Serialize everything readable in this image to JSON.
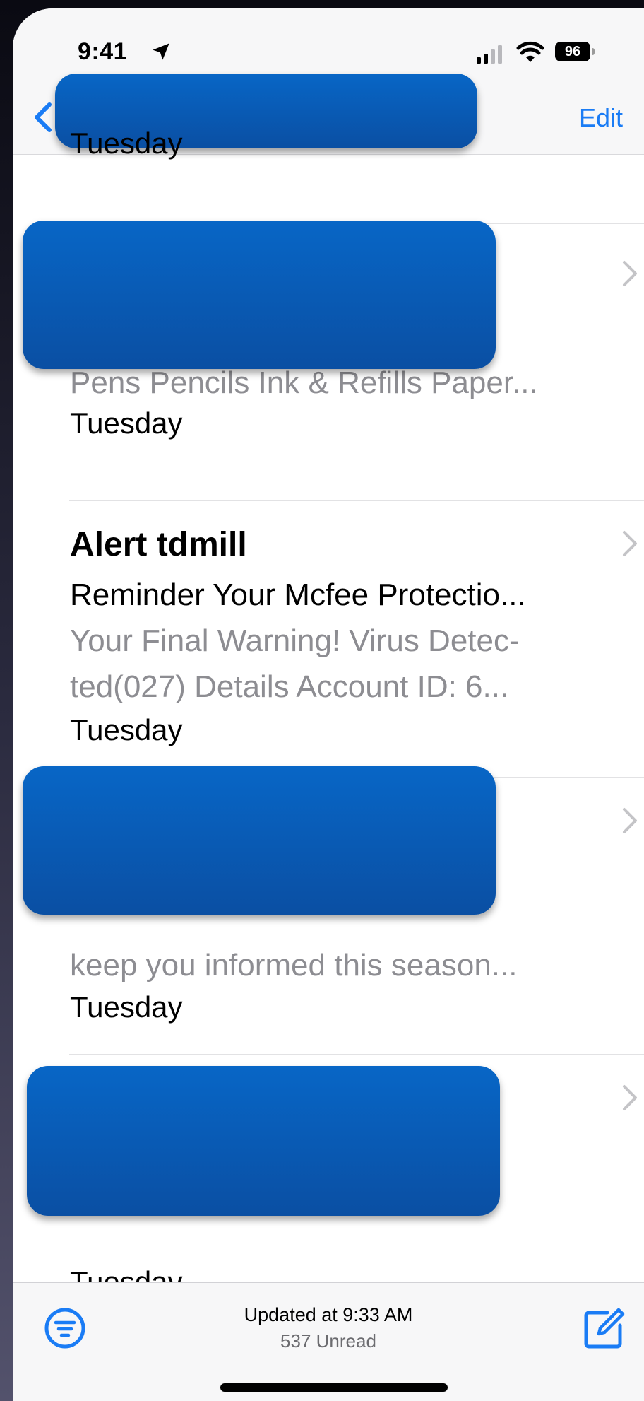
{
  "status_bar": {
    "time": "9:41",
    "battery": "96"
  },
  "nav": {
    "edit_label": "Edit"
  },
  "messages": [
    {
      "date": "Tuesday",
      "redacted": true
    },
    {
      "date": "Tuesday",
      "redacted": true,
      "partial_preview": "Pens Pencils Ink & Refills Paper..."
    },
    {
      "sender": "Alert tdmill",
      "subject": "Reminder Your Mcfee Protectio...",
      "preview_line1": "Your Final Warning! Virus Detec-",
      "preview_line2": "ted(027) Details Account ID: 6...",
      "date": "Tuesday"
    },
    {
      "date": "Tuesday",
      "redacted": true,
      "partial_preview": "keep you informed this season..."
    },
    {
      "date": "Tuesday",
      "redacted": true,
      "unread": true
    }
  ],
  "toolbar": {
    "updated": "Updated at 9:33 AM",
    "unread_count": "537 Unread"
  },
  "colors": {
    "accent": "#1a7cf5",
    "redaction": "#0a5bb5"
  }
}
